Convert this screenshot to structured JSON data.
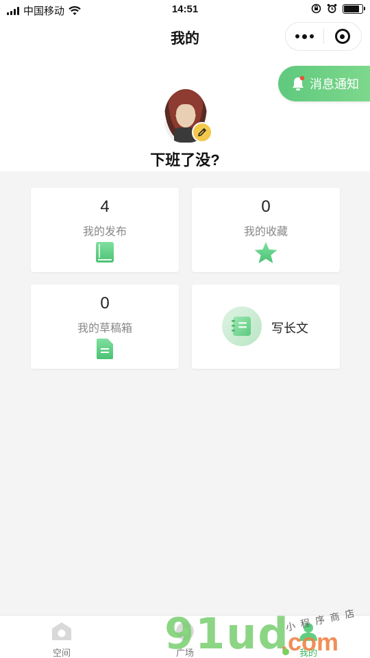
{
  "status_bar": {
    "carrier": "中国移动",
    "time": "14:51",
    "battery_level": 0.85
  },
  "header": {
    "title": "我的",
    "more_icon": "more-dots-icon",
    "close_icon": "target-close-icon"
  },
  "profile": {
    "notify_label": "消息通知",
    "nickname": "下班了没?"
  },
  "cards": {
    "published": {
      "count": "4",
      "label": "我的发布",
      "icon": "book-icon",
      "color": "#5fcf82"
    },
    "favorites": {
      "count": "0",
      "label": "我的收藏",
      "icon": "star-icon",
      "color": "#5fcf82"
    },
    "drafts": {
      "count": "0",
      "label": "我的草稿箱",
      "icon": "document-icon",
      "color": "#5fcf82"
    },
    "write": {
      "label": "写长文",
      "icon": "notebook-icon"
    }
  },
  "tabbar": {
    "tabs": [
      {
        "label": "空间",
        "icon": "home-icon"
      },
      {
        "label": "广场",
        "icon": "plaza-icon"
      },
      {
        "label": "我的",
        "icon": "profile-icon"
      }
    ],
    "active_color": "#3cb55e"
  },
  "watermark": {
    "main": "91ud",
    "suffix": ".com",
    "small": "小程序商店"
  }
}
